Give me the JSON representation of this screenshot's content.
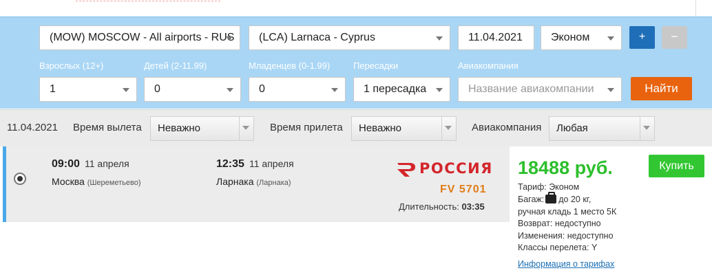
{
  "search": {
    "from": "(MOW) MOSCOW - All airports - RUS",
    "to": "(LCA) Larnaca - Cyprus",
    "date": "11.04.2021",
    "class": "Эконом",
    "plus_label": "+",
    "minus_label": "−",
    "adults_label": "Взрослых (12+)",
    "adults_value": "1",
    "children_label": "Детей (2-11.99)",
    "children_value": "0",
    "infants_label": "Младенцев (0-1.99)",
    "infants_value": "0",
    "transfers_label": "Пересадки",
    "transfers_value": "1 пересадка",
    "airline_label": "Авиакомпания",
    "airline_placeholder": "Название авиакомпании",
    "find_label": "Найти"
  },
  "filters": {
    "date": "11.04.2021",
    "departure_label": "Время вылета",
    "departure_value": "Неважно",
    "arrival_label": "Время прилета",
    "arrival_value": "Неважно",
    "airline_label": "Авиакомпания",
    "airline_value": "Любая"
  },
  "result": {
    "dep_time": "09:00",
    "dep_date": "11 апреля",
    "dep_city": "Москва",
    "dep_airport": "(Шереметьево)",
    "arr_time": "12:35",
    "arr_date": "11 апреля",
    "arr_city": "Ларнака",
    "arr_airport": "(Ларнака)",
    "airline_logo_text": "РОССИЯ",
    "flight_number": "FV 5701",
    "duration_label": "Длительность:",
    "duration_value": "03:35",
    "price": "18488 руб.",
    "buy_label": "Купить",
    "tariff": "Тариф: Эконом",
    "baggage_prefix": "Багаж:",
    "baggage_value": "до 20 кг,",
    "hand_luggage": "ручная кладь 1 место 5К",
    "refund": "Возврат: недоступно",
    "changes": "Изменения: недоступно",
    "booking_classes": "Классы перелета: Y",
    "tariff_link": "Информация о тарифах"
  },
  "colors": {
    "search_bg": "#a9d6f5",
    "find_button": "#e9630f",
    "buy_button": "#32c732",
    "price": "#2cbf2c",
    "flight_number": "#e07b16",
    "airline_red": "#d3262b",
    "plus_button": "#1f6fb8"
  }
}
